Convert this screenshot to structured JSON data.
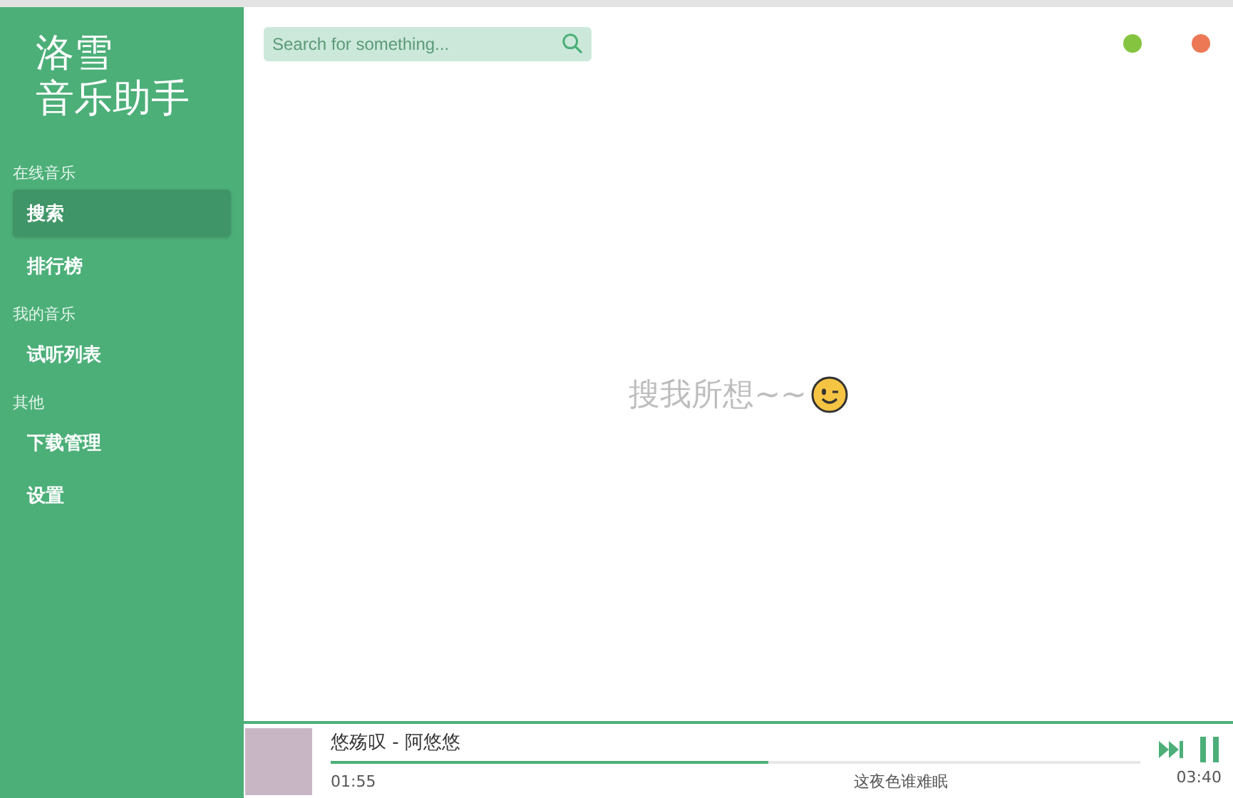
{
  "logo": {
    "line_1": "洛雪",
    "line_2": "音乐助手"
  },
  "sidebar": {
    "groups": [
      {
        "title": "在线音乐",
        "items": [
          {
            "label": "搜索",
            "selected": true
          },
          {
            "label": "排行榜",
            "selected": false
          }
        ]
      },
      {
        "title": "我的音乐",
        "items": [
          {
            "label": "试听列表",
            "selected": false
          }
        ]
      },
      {
        "title": "其他",
        "items": [
          {
            "label": "下载管理",
            "selected": false
          },
          {
            "label": "设置",
            "selected": false
          }
        ]
      }
    ]
  },
  "search": {
    "placeholder": "Search for something..."
  },
  "window_controls": [
    {
      "color": "#85c43f"
    },
    {
      "color": "#ec7856"
    }
  ],
  "empty_message": "搜我所想~~",
  "player": {
    "title": "悠殇叹 - 阿悠悠",
    "level": 0.54,
    "elapsed": "01:55",
    "lyric": "这夜色谁难眠",
    "duration": "03:40",
    "playing": true
  }
}
